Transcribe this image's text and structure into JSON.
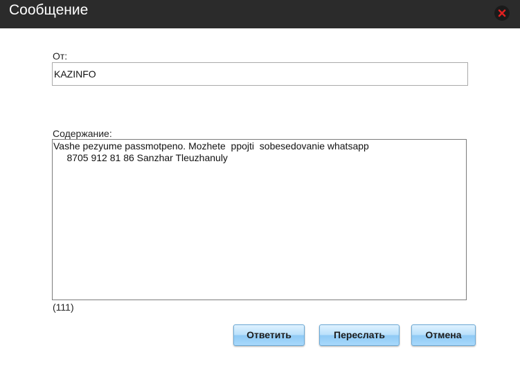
{
  "window": {
    "title": "Сообщение",
    "close_icon": "close-icon"
  },
  "from": {
    "label": "От:",
    "value": "KAZINFO"
  },
  "content": {
    "label": "Содержание:",
    "value": "Vashe pezyume passmotpeno. Mozhete  ppojti  sobesedovanie whatsapp\n     8705 912 81 86 Sanzhar Tleuzhanuly",
    "counter": "(111)"
  },
  "buttons": {
    "reply": "Ответить",
    "forward": "Переслать",
    "cancel": "Отмена"
  },
  "colors": {
    "titlebar": "#2b2b2b",
    "close_x": "#e02020",
    "button_gradient_top": "#dff2ff",
    "button_gradient_bottom": "#a8d8fb"
  }
}
